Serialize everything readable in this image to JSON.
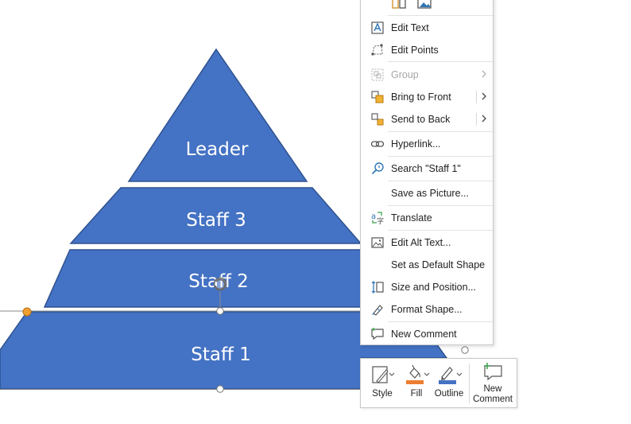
{
  "pyramid": {
    "tiers": [
      {
        "label": "Leader"
      },
      {
        "label": "Staff 3"
      },
      {
        "label": "Staff 2"
      },
      {
        "label": "Staff 1"
      }
    ],
    "fill_color": "#4472c4",
    "stroke_color": "#2f528f"
  },
  "context_menu": {
    "top_icons": [
      "layout-icon",
      "picture-icon"
    ],
    "items": [
      {
        "label": "Edit Text",
        "icon": "edit-text-icon",
        "disabled": false,
        "submenu": false
      },
      {
        "label": "Edit Points",
        "icon": "edit-points-icon",
        "disabled": false,
        "submenu": false
      },
      {
        "label": "Group",
        "icon": "group-icon",
        "disabled": true,
        "submenu": true
      },
      {
        "label": "Bring to Front",
        "icon": "bring-to-front-icon",
        "disabled": false,
        "submenu": true
      },
      {
        "label": "Send to Back",
        "icon": "send-to-back-icon",
        "disabled": false,
        "submenu": true
      },
      {
        "label": "Hyperlink...",
        "icon": "link-icon",
        "disabled": false,
        "submenu": false
      },
      {
        "label": "Search \"Staff 1\"",
        "icon": "search-icon",
        "disabled": false,
        "submenu": false
      },
      {
        "label": "Save as Picture...",
        "icon": "",
        "disabled": false,
        "submenu": false
      },
      {
        "label": "Translate",
        "icon": "translate-icon",
        "disabled": false,
        "submenu": false
      },
      {
        "label": "Edit Alt Text...",
        "icon": "alt-text-icon",
        "disabled": false,
        "submenu": false
      },
      {
        "label": "Set as Default Shape",
        "icon": "",
        "disabled": false,
        "submenu": false
      },
      {
        "label": "Size and Position...",
        "icon": "size-position-icon",
        "disabled": false,
        "submenu": false
      },
      {
        "label": "Format Shape...",
        "icon": "format-shape-icon",
        "disabled": false,
        "submenu": false
      },
      {
        "label": "New Comment",
        "icon": "comment-icon",
        "disabled": false,
        "submenu": false
      }
    ]
  },
  "mini_toolbar": {
    "style_label": "Style",
    "fill_label": "Fill",
    "outline_label": "Outline",
    "new_comment_line1": "New",
    "new_comment_line2": "Comment",
    "fill_color": "#ed7d31",
    "outline_color": "#4472c4"
  }
}
